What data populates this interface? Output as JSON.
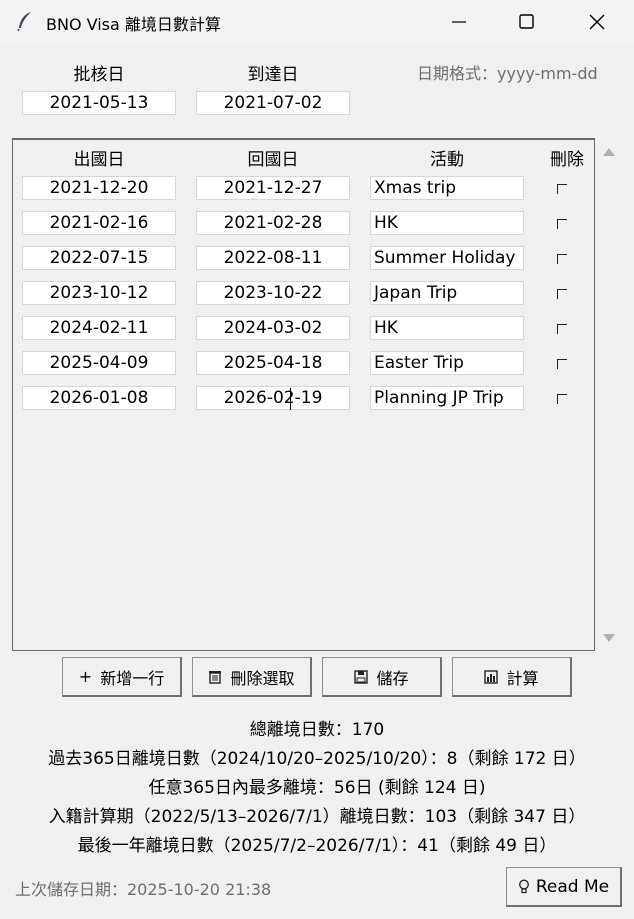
{
  "window": {
    "title": "BNO Visa 離境日數計算"
  },
  "approval": {
    "approve_label": "批核日",
    "arrive_label": "到達日",
    "approve_value": "2021-05-13",
    "arrive_value": "2021-07-02",
    "format_hint": "日期格式：yyyy-mm-dd"
  },
  "table": {
    "headers": [
      "出國日",
      "回國日",
      "活動",
      "刪除"
    ],
    "rows": [
      {
        "out": "2021-12-20",
        "back": "2021-12-27",
        "activity": "Xmas trip"
      },
      {
        "out": "2021-02-16",
        "back": "2021-02-28",
        "activity": "HK"
      },
      {
        "out": "2022-07-15",
        "back": "2022-08-11",
        "activity": "Summer Holiday"
      },
      {
        "out": "2023-10-12",
        "back": "2023-10-22",
        "activity": "Japan Trip"
      },
      {
        "out": "2024-02-11",
        "back": "2024-03-02",
        "activity": "HK"
      },
      {
        "out": "2025-04-09",
        "back": "2025-04-18",
        "activity": "Easter Trip"
      },
      {
        "out": "2026-01-08",
        "back": "2026-02-19",
        "activity": "Planning JP Trip"
      }
    ]
  },
  "buttons": {
    "add": "新增一行",
    "delete": "刪除選取",
    "save": "儲存",
    "calc": "計算"
  },
  "stats": {
    "total": "總離境日數：170",
    "past365": "過去365日離境日數（2024/10/20–2025/10/20）：8（剩餘 172 日）",
    "max365": "任意365日內最多離境：56日 (剩餘 124 日)",
    "naturalisation": "入籍計算期（2022/5/13–2026/7/1）離境日數：103（剩餘 347 日）",
    "last_year": "最後一年離境日數（2025/7/2–2026/7/1）：41（剩餘 49 日）"
  },
  "footer": {
    "last_saved": "上次儲存日期：2025-10-20 21:38",
    "readme": "Read Me"
  }
}
